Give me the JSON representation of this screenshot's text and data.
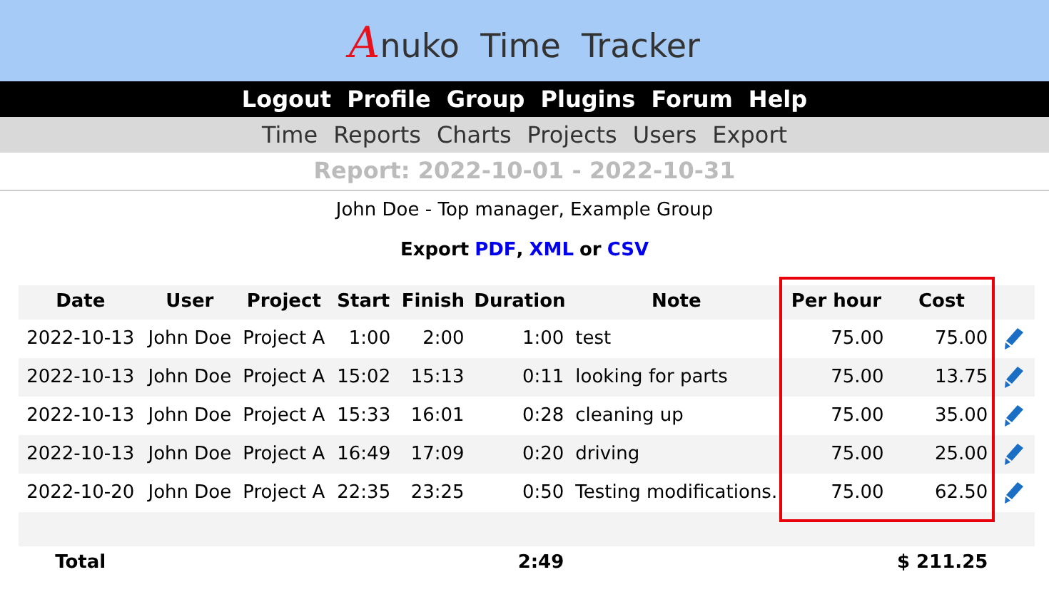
{
  "logo": {
    "initial": "A",
    "rest": "nuko Time Tracker"
  },
  "top_menu": [
    "Logout",
    "Profile",
    "Group",
    "Plugins",
    "Forum",
    "Help"
  ],
  "sub_menu": [
    "Time",
    "Reports",
    "Charts",
    "Projects",
    "Users",
    "Export"
  ],
  "report_title": "Report: 2022-10-01 - 2022-10-31",
  "user_line": "John Doe - Top manager, Example Group",
  "export": {
    "label": "Export",
    "links": [
      {
        "text": "PDF",
        "sep": ","
      },
      {
        "text": "XML",
        "sep": "or"
      },
      {
        "text": "CSV"
      }
    ]
  },
  "table": {
    "columns": [
      "Date",
      "User",
      "Project",
      "Start",
      "Finish",
      "Duration",
      "Note",
      "Per hour",
      "Cost"
    ],
    "rows": [
      {
        "cells": [
          "2022-10-13",
          "John Doe",
          "Project A",
          "1:00",
          "2:00",
          "1:00",
          "test",
          "75.00",
          "75.00"
        ]
      },
      {
        "cells": [
          "2022-10-13",
          "John Doe",
          "Project A",
          "15:02",
          "15:13",
          "0:11",
          "looking for parts",
          "75.00",
          "13.75"
        ]
      },
      {
        "cells": [
          "2022-10-13",
          "John Doe",
          "Project A",
          "15:33",
          "16:01",
          "0:28",
          "cleaning up",
          "75.00",
          "35.00"
        ]
      },
      {
        "cells": [
          "2022-10-13",
          "John Doe",
          "Project A",
          "16:49",
          "17:09",
          "0:20",
          "driving",
          "75.00",
          "25.00"
        ]
      },
      {
        "cells": [
          "2022-10-20",
          "John Doe",
          "Project A",
          "22:35",
          "23:25",
          "0:50",
          "Testing modifications.",
          "75.00",
          "62.50"
        ]
      }
    ],
    "total": {
      "label": "Total",
      "duration": "2:49",
      "cost": "$ 211.25"
    }
  }
}
